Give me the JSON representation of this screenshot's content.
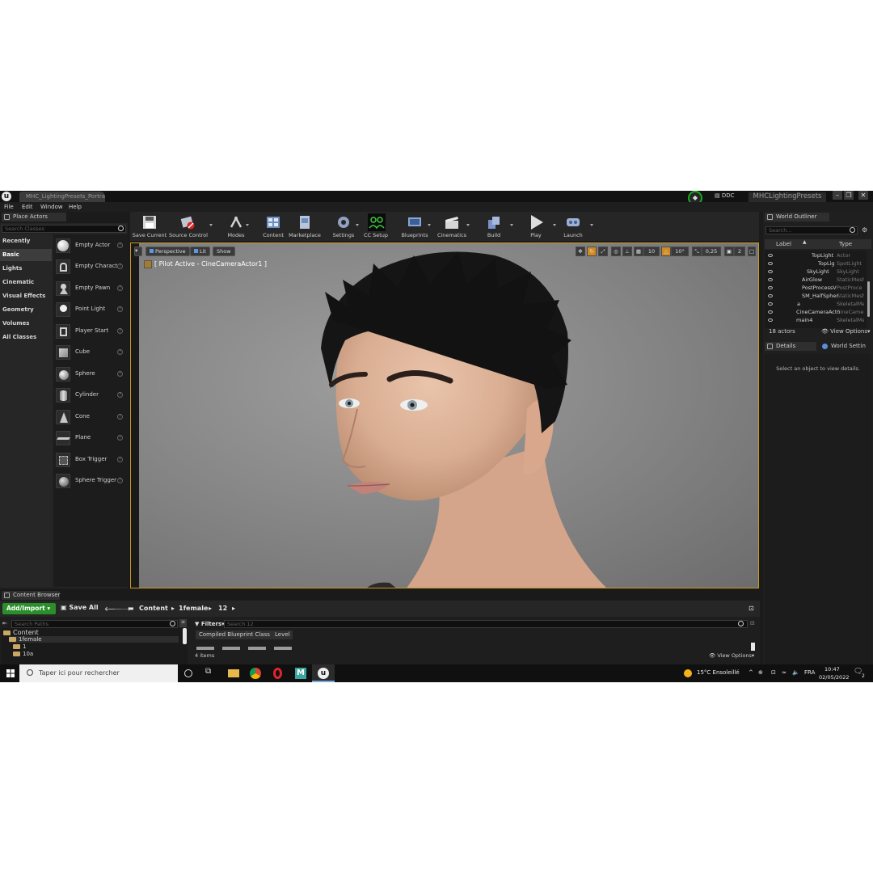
{
  "window": {
    "tab_title": "MHC_LightingPresets_Portrai",
    "ddc_label": "DDC",
    "project_name": "MHCLightingPresets",
    "controls": [
      "–",
      "❐",
      "✕"
    ]
  },
  "menu": [
    "File",
    "Edit",
    "Window",
    "Help"
  ],
  "place_actors": {
    "tab_label": "Place Actors",
    "search_placeholder": "Search Classes",
    "categories": [
      "Recently Placed",
      "Basic",
      "Lights",
      "Cinematic",
      "Visual Effects",
      "Geometry",
      "Volumes",
      "All Classes"
    ],
    "active_category": "Basic",
    "actors": [
      {
        "label": "Empty Actor",
        "icon": "sphere-white-icon"
      },
      {
        "label": "Empty Charact",
        "icon": "character-icon"
      },
      {
        "label": "Empty Pawn",
        "icon": "pawn-icon"
      },
      {
        "label": "Point Light",
        "icon": "bulb-icon"
      },
      {
        "label": "Player Start",
        "icon": "player-start-icon"
      },
      {
        "label": "Cube",
        "icon": "cube-icon"
      },
      {
        "label": "Sphere",
        "icon": "sphere-icon"
      },
      {
        "label": "Cylinder",
        "icon": "cylinder-icon"
      },
      {
        "label": "Cone",
        "icon": "cone-icon"
      },
      {
        "label": "Plane",
        "icon": "plane-icon"
      },
      {
        "label": "Box Trigger",
        "icon": "box-trigger-icon"
      },
      {
        "label": "Sphere Trigger",
        "icon": "sphere-trigger-icon"
      }
    ]
  },
  "toolbar": {
    "buttons": [
      {
        "label": "Save Current",
        "icon": "save-icon"
      },
      {
        "label": "Source Control",
        "icon": "source-control-icon"
      },
      {
        "label": "Modes",
        "icon": "modes-icon"
      },
      {
        "label": "Content",
        "icon": "content-icon"
      },
      {
        "label": "Marketplace",
        "icon": "marketplace-icon"
      },
      {
        "label": "Settings",
        "icon": "settings-icon"
      },
      {
        "label": "CC Setup",
        "icon": "cc-setup-icon"
      },
      {
        "label": "Blueprints",
        "icon": "blueprints-icon"
      },
      {
        "label": "Cinematics",
        "icon": "cinematics-icon"
      },
      {
        "label": "Build",
        "icon": "build-icon"
      },
      {
        "label": "Play",
        "icon": "play-icon"
      },
      {
        "label": "Launch",
        "icon": "launch-icon"
      }
    ]
  },
  "viewport": {
    "perspective_label": "Perspective",
    "lit_label": "Lit",
    "show_label": "Show",
    "pilot_text": "[ Pilot Active - CineCameraActor1 ]",
    "grid_snap": "10",
    "rotation_snap": "10°",
    "scale_snap": "0,25",
    "camera_speed": "2"
  },
  "world_outliner": {
    "tab_label": "World Outliner",
    "search_placeholder": "Search...",
    "col_label": "Label",
    "col_type": "Type",
    "rows": [
      {
        "label": "TopLight",
        "type": "Actor"
      },
      {
        "label": "TopLig",
        "type": "SpotLight"
      },
      {
        "label": "SkyLight",
        "type": "SkyLight"
      },
      {
        "label": "AirGlow",
        "type": "StaticMesh"
      },
      {
        "label": "PostProcessV",
        "type": "PostProce"
      },
      {
        "label": "SM_HalfSpher",
        "type": "StaticMesh"
      },
      {
        "label": "a",
        "type": "SkeletalMe"
      },
      {
        "label": "CineCameraActo",
        "type": "CineCame"
      },
      {
        "label": "main4",
        "type": "SkeletalMe"
      }
    ],
    "actor_count": "18 actors",
    "view_options": "View Options"
  },
  "details": {
    "tab_label": "Details",
    "world_settings_tab": "World Settin",
    "empty_message": "Select an object to view details."
  },
  "content_browser": {
    "tab_label": "Content Browser",
    "add_import": "Add/Import",
    "save_all": "Save All",
    "breadcrumb": [
      "Content",
      "1female",
      "12"
    ],
    "search_paths_placeholder": "Search Paths",
    "filters_label": "Filters",
    "search_placeholder": "Search 12",
    "tree": [
      "Content",
      "1female",
      "1",
      "10a"
    ],
    "filter_chips": [
      "Compiled Blueprint Class",
      "Level"
    ],
    "item_count": "4 items",
    "view_options": "View Options"
  },
  "taskbar": {
    "search_placeholder": "Taper ici pour rechercher",
    "weather": "15°C  Ensoleillé",
    "language": "FRA",
    "time": "10:47",
    "date": "02/05/2022",
    "notifications": "2"
  },
  "colors": {
    "viewport_border": "#c89a1c",
    "add_import_green": "#2a8f2a",
    "source_control_ring": "#18a820"
  }
}
